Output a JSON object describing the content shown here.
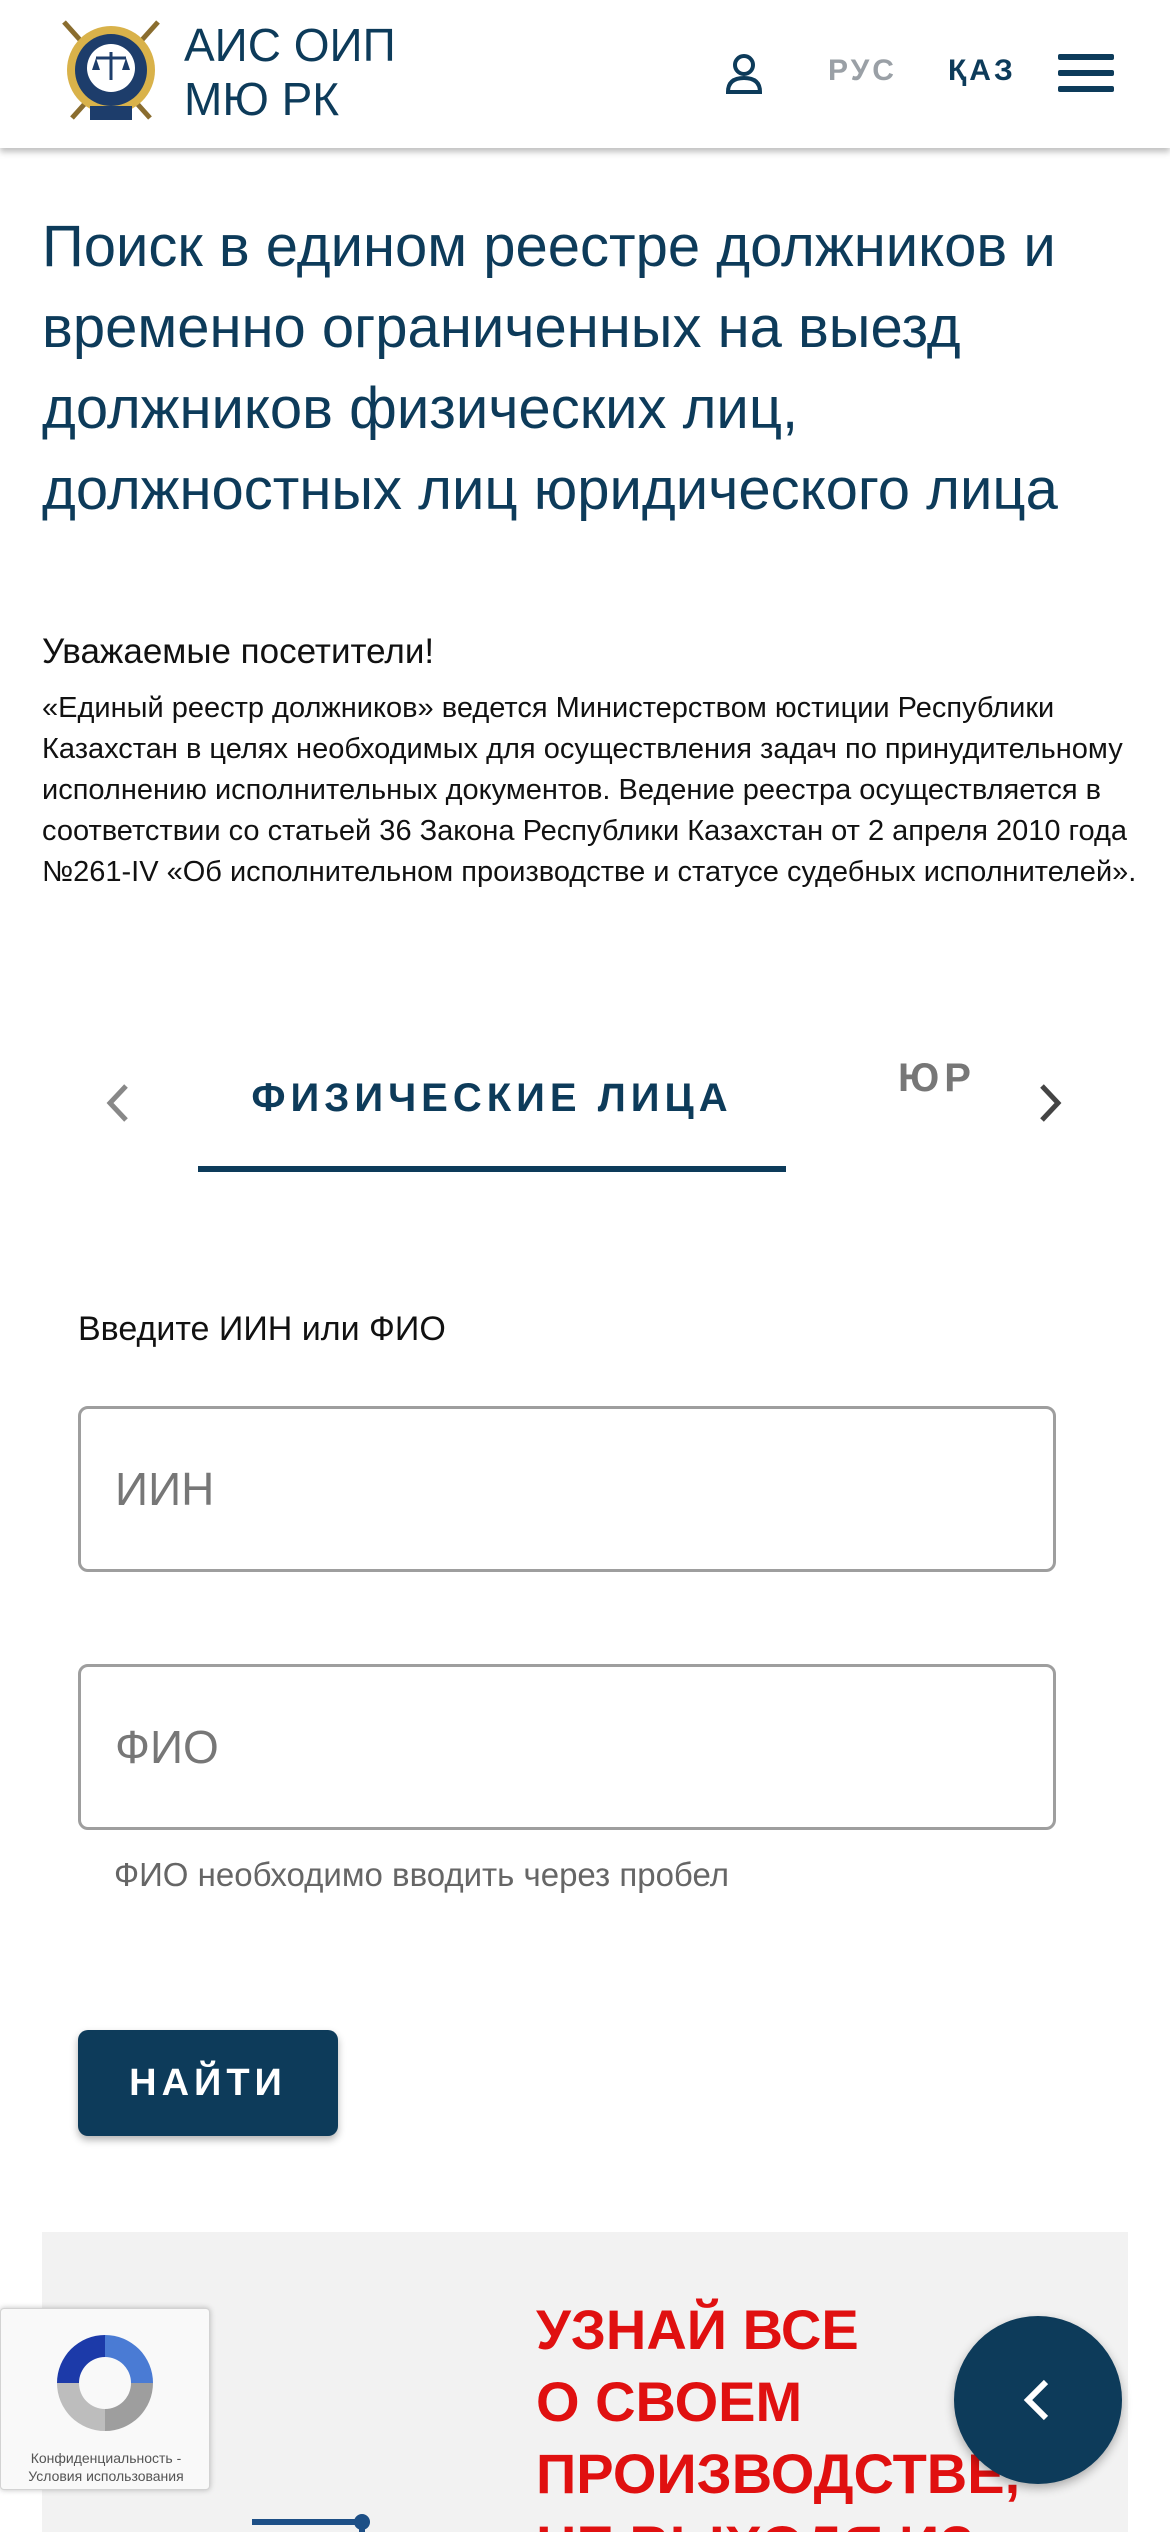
{
  "header": {
    "brand_line1": "АИС ОИП",
    "brand_line2": "МЮ РК",
    "logo_icon": "ministry-emblem-icon",
    "user_icon": "user-icon",
    "lang_rus": "РУС",
    "lang_kaz": "ҚАЗ",
    "menu_icon": "hamburger-menu-icon"
  },
  "main": {
    "title": "Поиск в едином реестре должников и временно ограниченных на выезд должников физических лиц, должностных лиц юридического лица",
    "greeting": "Уважаемые посетители!",
    "intro": "«Единый реестр должников» ведется Министерством юстиции Республики Казахстан в целях необходимых для осуществления задач по принудительному исполнению исполнительных документов. Ведение реестра осуществляется в соответствии со статьей 36 Закона Республики Казахстан от 2 апреля 2010 года №261-IV «Об исполнительном производстве и статусе судебных исполнителей»."
  },
  "tabs": {
    "active": "ФИЗИЧЕСКИЕ ЛИЦА",
    "next_partial": "ЮР"
  },
  "form": {
    "label": "Введите ИИН или ФИО",
    "iin_placeholder": "ИИН",
    "fio_placeholder": "ФИО",
    "fio_helper": "ФИО необходимо вводить через пробел",
    "search_button": "НАЙТИ"
  },
  "promo": {
    "line1": "УЗНАЙ ВСЕ",
    "line2": "О СВОЕМ",
    "line3": "ПРОИЗВОДСТВЕ,",
    "line4": "НЕ ВЫХОДЯ ИЗ"
  },
  "recaptcha": {
    "text": "Конфиденциальность - Условия использования"
  },
  "colors": {
    "primary": "#0d3b5a",
    "promo_red": "#e01010",
    "muted": "#9aa0a6"
  }
}
